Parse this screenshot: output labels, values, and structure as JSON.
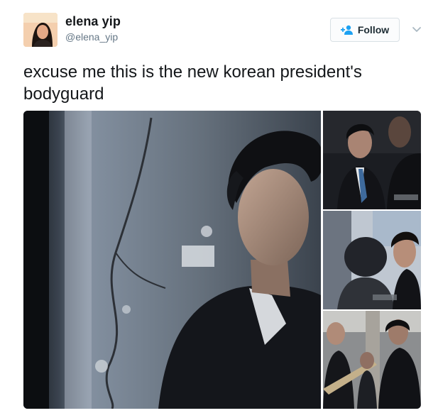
{
  "user": {
    "display_name": "elena yip",
    "handle": "@elena_yip",
    "avatar_icon": "user-avatar"
  },
  "follow_button": {
    "label": "Follow",
    "icon": "add-user-icon",
    "accent": "#1da1f2"
  },
  "menu": {
    "icon": "chevron-down-icon"
  },
  "tweet": {
    "text": "excuse me this is the new korean president's bodyguard"
  },
  "media": {
    "photos": [
      {
        "description_icon": "photo-main"
      },
      {
        "description_icon": "photo-thumb-1"
      },
      {
        "description_icon": "photo-thumb-2"
      },
      {
        "description_icon": "photo-thumb-3"
      }
    ]
  }
}
